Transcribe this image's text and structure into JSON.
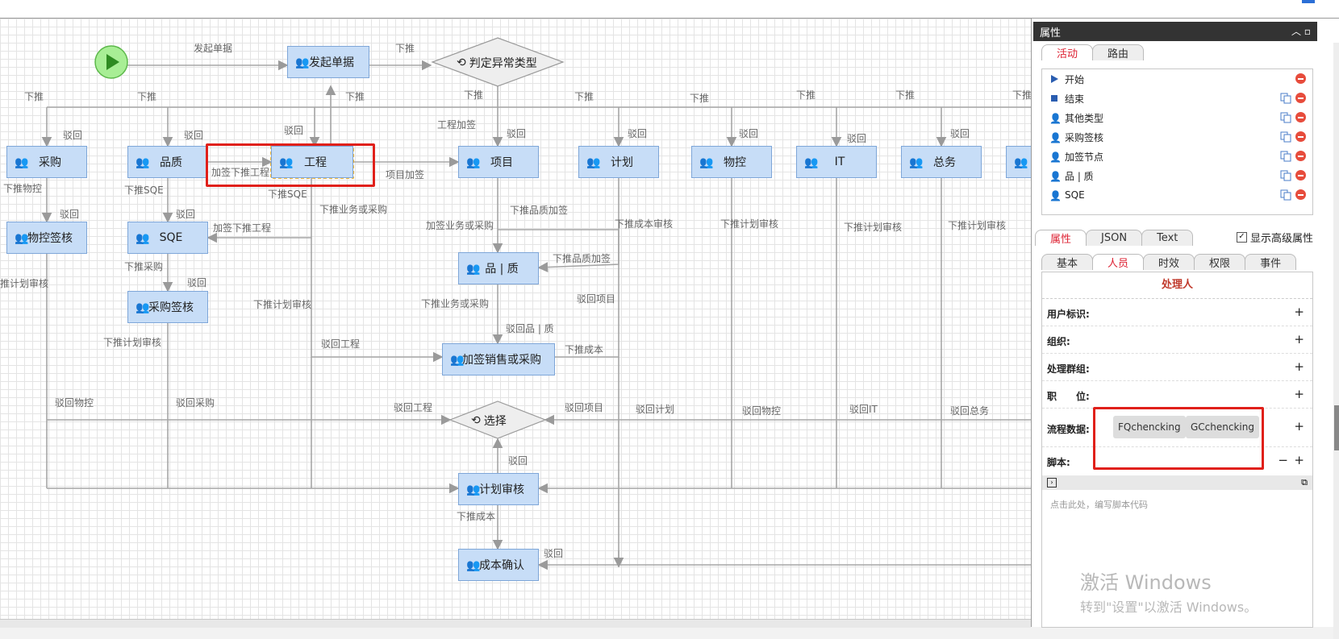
{
  "canvas": {
    "nodes": {
      "start_id": "start",
      "faqi": "发起单据",
      "panding": "判定异常类型",
      "caigou": "采购",
      "pinzhi": "品质",
      "gongcheng": "工程",
      "xiangmu": "项目",
      "jihua": "计划",
      "wukong": "物控",
      "it": "IT",
      "zongwu": "总务",
      "wukong_qianhe": "物控签核",
      "sqe": "SQE",
      "caigou_qianhe": "采购签核",
      "pin_zhi": "品 | 质",
      "jiaqian_xiaoshou": "加签销售或采购",
      "xuanze": "选择",
      "jihua_shenhe": "计划审核",
      "chengben_queren": "成本确认"
    },
    "labels": {
      "faqidanju": "发起单据",
      "xiatui_top": "下推",
      "xiatui": "下推",
      "bohui": "驳回",
      "gongcheng_jiaqian": "工程加签",
      "jiaqian_xiatui_gongcheng": "加签下推工程",
      "xiangmu_jiaqian": "项目加签",
      "xiatui_wukong": "下推物控",
      "xiatui_sqe": "下推SQE",
      "xiatui_caigou": "下推采购",
      "xiatui_yewu_caigou": "下推业务或采购",
      "jiaqian_yewu_caigou": "加签业务或采购",
      "xiatui_pinzhi_jiaqian": "下推品质加签",
      "xiatui_chengben_shenhe": "下推成本审核",
      "xiatui_jihua_shenhe": "下推计划审核",
      "bohui_xiangmu": "驳回项目",
      "bohui_pinzhi": "驳回品 | 质",
      "bohui_gongcheng": "驳回工程",
      "xiatui_chengben": "下推成本",
      "bohui_wukong": "驳回物控",
      "bohui_caigou": "驳回采购",
      "bohui_jihua": "驳回计划",
      "bohui_it": "驳回IT",
      "bohui_zongwu": "驳回总务",
      "ji_hua_shenhe_trunc": "推计划审核"
    }
  },
  "panel": {
    "title": "属性",
    "top_tabs": [
      "活动",
      "路由"
    ],
    "activities": [
      {
        "label": "开始",
        "icon": "play-icon",
        "copy": false
      },
      {
        "label": "结束",
        "icon": "stop-icon",
        "copy": true
      },
      {
        "label": "其他类型",
        "icon": "user-icon",
        "copy": true
      },
      {
        "label": "采购签核",
        "icon": "user-icon",
        "copy": true
      },
      {
        "label": "加签节点",
        "icon": "user-icon",
        "copy": true
      },
      {
        "label": "品 | 质",
        "icon": "user-icon",
        "copy": true
      },
      {
        "label": "SQE",
        "icon": "user-icon",
        "copy": true
      }
    ],
    "mid_tabs": [
      "属性",
      "JSON",
      "Text"
    ],
    "show_advanced": "显示高级属性",
    "sub_tabs": [
      "基本",
      "人员",
      "时效",
      "权限",
      "事件"
    ],
    "section_title": "处理人",
    "rows": {
      "user_id": "用户标识:",
      "org": "组织:",
      "group": "处理群组:",
      "position": "职　　位:",
      "flow_data": "流程数据:",
      "script": "脚本:"
    },
    "chips": [
      "FQchencking",
      "GCchencking"
    ],
    "script_placeholder": "点击此处，编写脚本代码",
    "plus": "+",
    "minus": "−"
  },
  "watermark": {
    "line1": "激活 Windows",
    "line2": "转到\"设置\"以激活 Windows。"
  },
  "colors": {
    "node_fill": "#c7ddf7",
    "node_border": "#7ea6d8",
    "highlight": "#e0201a",
    "tab_active": "#d23"
  }
}
